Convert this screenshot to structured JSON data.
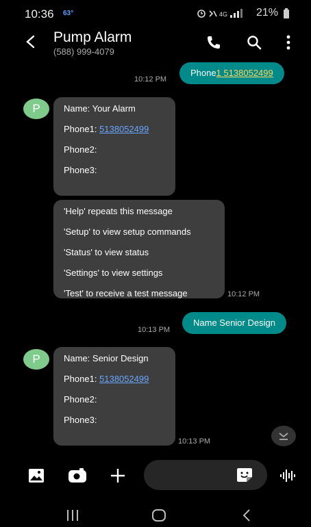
{
  "status": {
    "time": "10:36",
    "temperature": "63°",
    "icons": "⏰ 🔇 4G ▂▄▆",
    "battery": "21%"
  },
  "header": {
    "contact_name": "Pump Alarm",
    "contact_phone": "(588) 999-4079",
    "icons": [
      "back-arrow-icon",
      "phone-icon",
      "search-icon",
      "more-vertical-icon"
    ]
  },
  "messages": {
    "m1": {
      "text": "Phone",
      "link": "1 5138052499",
      "time": "10:12 PM"
    },
    "m2": {
      "avatar": "P",
      "name_line": "Name: Your Alarm",
      "phone1_label": "Phone1: ",
      "phone1_link": "5138052499",
      "phone2": "Phone2:",
      "phone3": "Phone3:"
    },
    "m3": {
      "lines": [
        "'Help' repeats this message",
        "'Setup' to view setup commands",
        "'Status' to view status",
        "'Settings' to view settings",
        "'Test' to receive a test message"
      ],
      "time": "10:12 PM"
    },
    "m4": {
      "text": "Name Senior Design",
      "time": "10:13 PM"
    },
    "m5": {
      "avatar": "P",
      "name_line": "Name: Senior Design",
      "phone1_label": "Phone1: ",
      "phone1_link": "5138052499",
      "phone2": "Phone2:",
      "phone3": "Phone3:",
      "time": "10:13 PM"
    }
  },
  "compose": {
    "placeholder": "",
    "icons": [
      "gallery-icon",
      "camera-icon",
      "plus-icon",
      "sticker-icon",
      "voice-icon"
    ]
  },
  "colors": {
    "sent_bubble": "#008a8a",
    "received_bubble": "#3e3e3e",
    "avatar": "#7ecb8c",
    "link": "#6aa6ff"
  }
}
